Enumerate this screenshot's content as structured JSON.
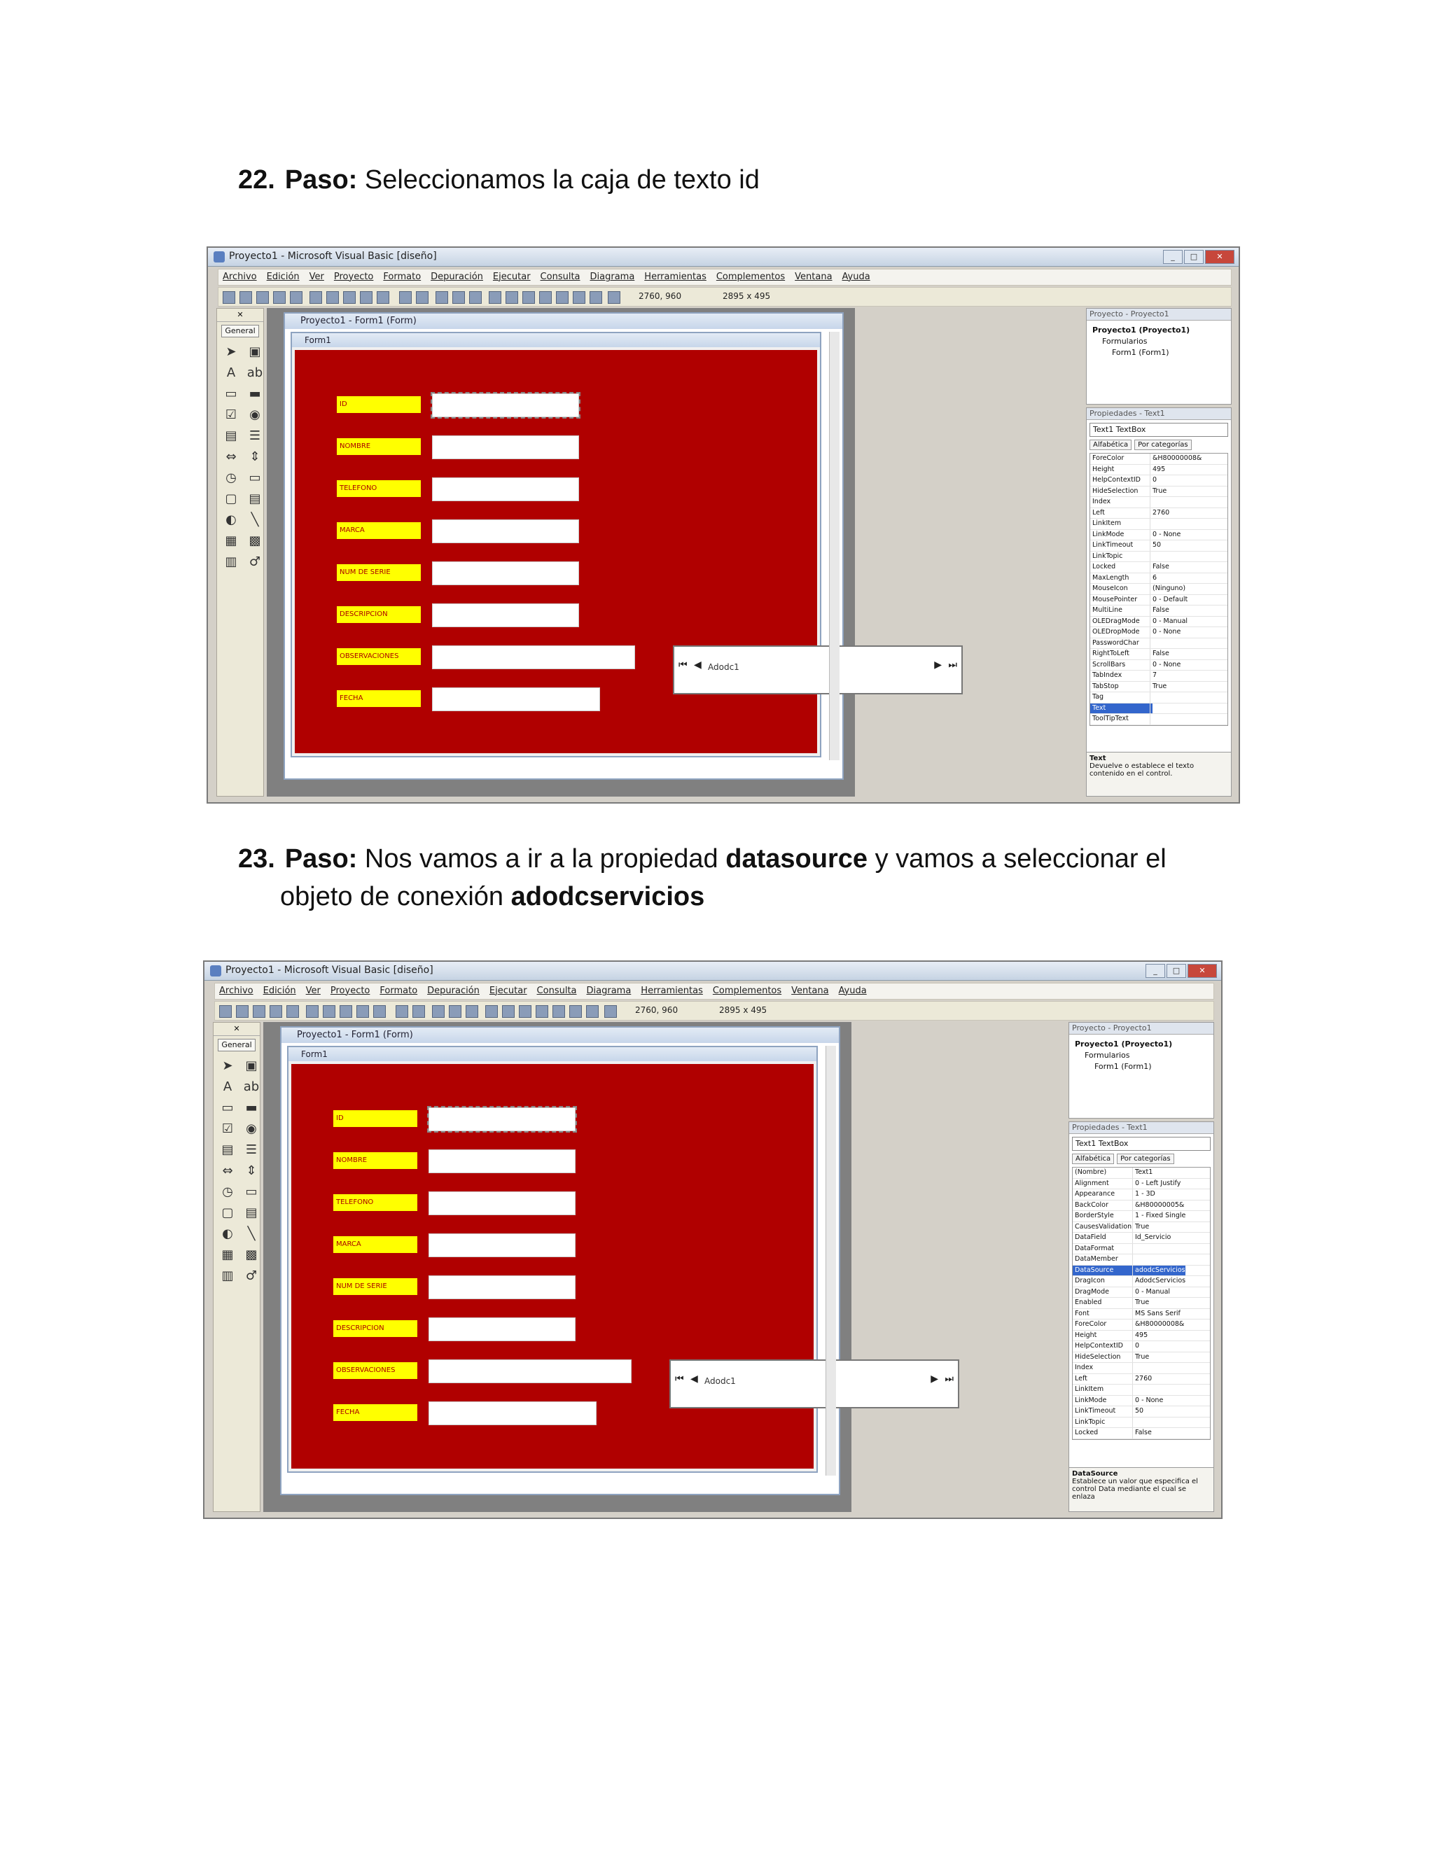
{
  "steps": [
    {
      "number": "22.",
      "label": "Paso:",
      "text": "Seleccionamos la caja de texto id"
    },
    {
      "number": "23.",
      "label": "Paso:",
      "text_a": "Nos vamos a ir a la propiedad",
      "bold_a": "datasource",
      "text_b": "y vamos a seleccionar el",
      "text_c": "objeto de conexión",
      "bold_b": "adodcservicios"
    }
  ],
  "ide": {
    "title": "Proyecto1 - Microsoft Visual Basic [diseño]",
    "menu": [
      "Archivo",
      "Edición",
      "Ver",
      "Proyecto",
      "Formato",
      "Depuración",
      "Ejecutar",
      "Consulta",
      "Diagrama",
      "Herramientas",
      "Complementos",
      "Ventana",
      "Ayuda"
    ],
    "coords_pos": "2760, 960",
    "coords_size": "2895 x 495",
    "toolbox_general": "General",
    "project_window_title": "Proyecto1 - Form1 (Form)",
    "form_title": "Form1",
    "labels": [
      "ID",
      "NOMBRE",
      "TELEFONO",
      "MARCA",
      "NUM DE SERIE",
      "DESCRIPCION",
      "OBSERVACIONES",
      "FECHA"
    ],
    "adodc_caption": "Adodc1",
    "explorer_title": "Proyecto - Proyecto1",
    "tree": [
      "Proyecto1 (Proyecto1)",
      "Formularios",
      "Form1 (Form1)"
    ],
    "props_title": "Propiedades - Text1",
    "props_object": "Text1 TextBox",
    "tab_alpha": "Alfabética",
    "tab_cat": "Por categorías"
  },
  "shot1_props": [
    [
      "ForeColor",
      "&H80000008&"
    ],
    [
      "Height",
      "495"
    ],
    [
      "HelpContextID",
      "0"
    ],
    [
      "HideSelection",
      "True"
    ],
    [
      "Index",
      ""
    ],
    [
      "Left",
      "2760"
    ],
    [
      "LinkItem",
      ""
    ],
    [
      "LinkMode",
      "0 - None"
    ],
    [
      "LinkTimeout",
      "50"
    ],
    [
      "LinkTopic",
      ""
    ],
    [
      "Locked",
      "False"
    ],
    [
      "MaxLength",
      "6"
    ],
    [
      "MouseIcon",
      "(Ninguno)"
    ],
    [
      "MousePointer",
      "0 - Default"
    ],
    [
      "MultiLine",
      "False"
    ],
    [
      "OLEDragMode",
      "0 - Manual"
    ],
    [
      "OLEDropMode",
      "0 - None"
    ],
    [
      "PasswordChar",
      ""
    ],
    [
      "RightToLeft",
      "False"
    ],
    [
      "ScrollBars",
      "0 - None"
    ],
    [
      "TabIndex",
      "7"
    ],
    [
      "TabStop",
      "True"
    ],
    [
      "Tag",
      ""
    ],
    [
      "Text",
      ""
    ],
    [
      "ToolTipText",
      ""
    ]
  ],
  "shot1_desc_title": "Text",
  "shot1_desc": "Devuelve o establece el texto contenido en el control.",
  "shot2_props": [
    [
      "(Nombre)",
      "Text1"
    ],
    [
      "Alignment",
      "0 - Left Justify"
    ],
    [
      "Appearance",
      "1 - 3D"
    ],
    [
      "BackColor",
      "&H80000005&"
    ],
    [
      "BorderStyle",
      "1 - Fixed Single"
    ],
    [
      "CausesValidation",
      "True"
    ],
    [
      "DataField",
      "Id_Servicio"
    ],
    [
      "DataFormat",
      ""
    ],
    [
      "DataMember",
      ""
    ],
    [
      "DataSource",
      "adodcServicios"
    ],
    [
      "DragIcon",
      "AdodcServicios"
    ],
    [
      "DragMode",
      "0 - Manual"
    ],
    [
      "Enabled",
      "True"
    ],
    [
      "Font",
      "MS Sans Serif"
    ],
    [
      "ForeColor",
      "&H80000008&"
    ],
    [
      "Height",
      "495"
    ],
    [
      "HelpContextID",
      "0"
    ],
    [
      "HideSelection",
      "True"
    ],
    [
      "Index",
      ""
    ],
    [
      "Left",
      "2760"
    ],
    [
      "LinkItem",
      ""
    ],
    [
      "LinkMode",
      "0 - None"
    ],
    [
      "LinkTimeout",
      "50"
    ],
    [
      "LinkTopic",
      ""
    ],
    [
      "Locked",
      "False"
    ]
  ],
  "shot2_desc_title": "DataSource",
  "shot2_desc": "Establece un valor que especifica el control Data mediante el cual se enlaza"
}
